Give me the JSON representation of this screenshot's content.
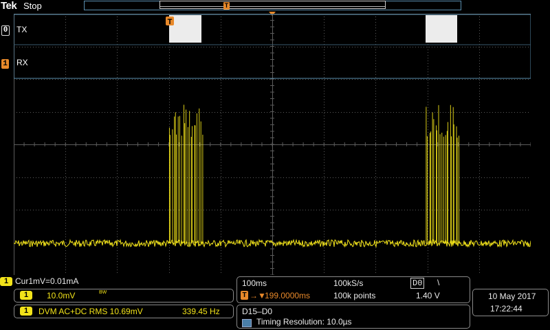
{
  "header": {
    "brand": "Tek",
    "status": "Stop",
    "trigger_marker": "T"
  },
  "colors": {
    "background": "#000000",
    "ch1_yellow": "#f2e31a",
    "graticule": "#5c5c5c",
    "bus_border": "#5a8fb0",
    "trigger_orange": "#e8892a"
  },
  "channels": {
    "digital0": {
      "marker": "0",
      "label": "TX"
    },
    "digital1": {
      "marker": "1",
      "label": "RX"
    }
  },
  "cursor": {
    "chip": "1",
    "text": "Cur1mV=0.01mA"
  },
  "channel1": {
    "chip": "1",
    "scale": "10.0mV",
    "bandwidth_icon": "BW"
  },
  "dvm": {
    "chip": "1",
    "mode": "DVM AC+DC RMS 10.69mV",
    "frequency": "339.45 Hz"
  },
  "horizontal": {
    "time_per_div": "100ms",
    "sample_rate": "100kS/s",
    "trigger_source": "D0",
    "trigger_slope": "\\",
    "trigger_chip": "T",
    "trigger_position": "199.0000ms",
    "record_length": "100k points",
    "trigger_level": "1.40 V"
  },
  "digital_group": {
    "label": "D15–D0",
    "timing_resolution": "Timing Resolution: 10.0µs",
    "icon": "digital-resolution-icon"
  },
  "datetime": {
    "date": "10 May  2017",
    "time": "17:22:44"
  }
}
